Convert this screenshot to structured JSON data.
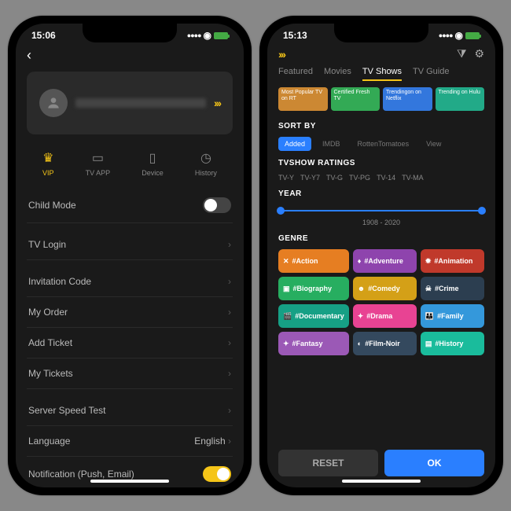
{
  "phone1": {
    "time": "15:06",
    "profile": {
      "chevrons": "›››"
    },
    "quick_actions": [
      {
        "icon": "♛",
        "label": "VIP"
      },
      {
        "icon": "▭",
        "label": "TV APP"
      },
      {
        "icon": "▯",
        "label": "Device"
      },
      {
        "icon": "◷",
        "label": "History"
      }
    ],
    "settings": {
      "child_mode": "Child Mode",
      "tv_login": "TV Login",
      "invitation": "Invitation Code",
      "my_order": "My Order",
      "add_ticket": "Add Ticket",
      "my_tickets": "My Tickets",
      "speed_test": "Server Speed Test",
      "language_label": "Language",
      "language_value": "English",
      "notification": "Notification (Push, Email)"
    }
  },
  "phone2": {
    "time": "15:13",
    "logo": "›››",
    "tabs": [
      "Featured",
      "Movies",
      "TV Shows",
      "TV Guide"
    ],
    "active_tab": "TV Shows",
    "chips": [
      {
        "label": "Most Popular TV on RT",
        "color": "red"
      },
      {
        "label": "Certified Fresh TV",
        "color": "green"
      },
      {
        "label": "Trendingon on Netflix",
        "color": "blue"
      },
      {
        "label": "Trending on Hulu",
        "color": "teal"
      }
    ],
    "sort_by_label": "SORT BY",
    "sort_options": [
      "Added",
      "IMDB",
      "RottenTomatoes",
      "View"
    ],
    "sort_active": "Added",
    "ratings_label": "TVSHOW RATINGS",
    "ratings": [
      "TV-Y",
      "TV-Y7",
      "TV-G",
      "TV-PG",
      "TV-14",
      "TV-MA"
    ],
    "year_label": "YEAR",
    "year_range": "1908 - 2020",
    "genre_label": "GENRE",
    "genres": [
      {
        "icon": "✕",
        "label": "#Action",
        "bg": "#e67e22"
      },
      {
        "icon": "♦",
        "label": "#Adventure",
        "bg": "#8e44ad"
      },
      {
        "icon": "✹",
        "label": "#Animation",
        "bg": "#c0392b"
      },
      {
        "icon": "▣",
        "label": "#Biography",
        "bg": "#27ae60"
      },
      {
        "icon": "☻",
        "label": "#Comedy",
        "bg": "#d4a017"
      },
      {
        "icon": "☠",
        "label": "#Crime",
        "bg": "#2c3e50"
      },
      {
        "icon": "🎬",
        "label": "#Documentary",
        "bg": "#16a085"
      },
      {
        "icon": "✦",
        "label": "#Drama",
        "bg": "#e84393"
      },
      {
        "icon": "👪",
        "label": "#Family",
        "bg": "#3498db"
      },
      {
        "icon": "✦",
        "label": "#Fantasy",
        "bg": "#9b59b6"
      },
      {
        "icon": "◐",
        "label": "#Film-Noir",
        "bg": "#34495e"
      },
      {
        "icon": "▤",
        "label": "#History",
        "bg": "#1abc9c"
      }
    ],
    "reset_label": "RESET",
    "ok_label": "OK"
  }
}
